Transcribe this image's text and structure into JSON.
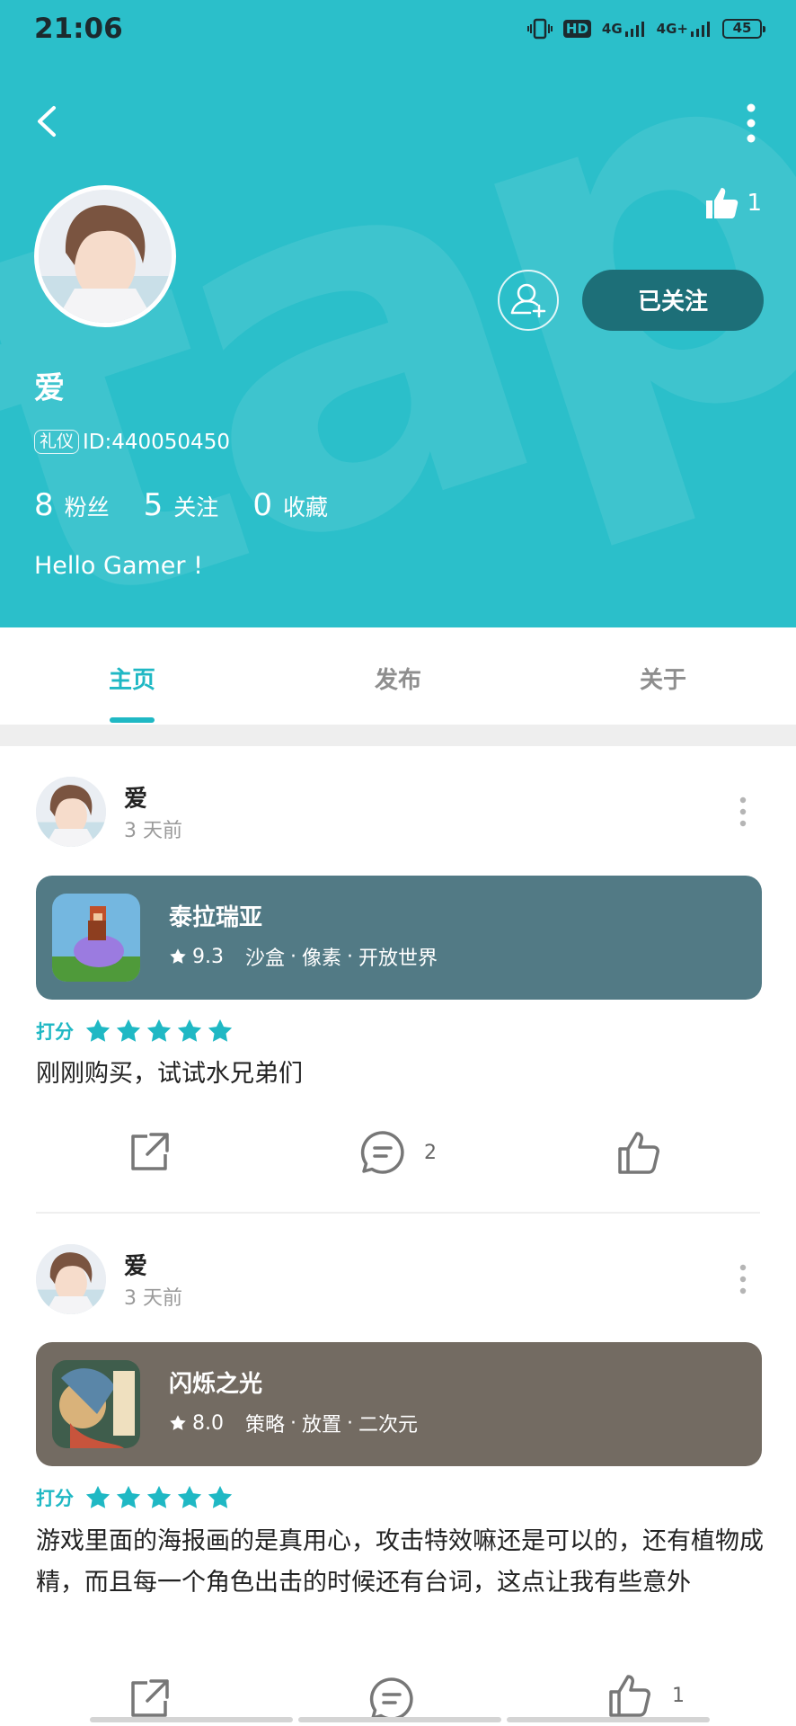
{
  "status_bar": {
    "time": "21:06",
    "hd": "HD",
    "network1": "4G",
    "network2": "4G+",
    "battery": "45"
  },
  "header": {
    "watermark": "tap",
    "like_count": "1",
    "username": "爱",
    "badge": "礼仪",
    "user_id": "ID:440050450",
    "follow_label": "已关注",
    "stats": [
      {
        "value": "8",
        "label": "粉丝"
      },
      {
        "value": "5",
        "label": "关注"
      },
      {
        "value": "0",
        "label": "收藏"
      }
    ],
    "bio": "Hello Gamer !"
  },
  "tabs": [
    {
      "label": "主页",
      "active": true
    },
    {
      "label": "发布",
      "active": false
    },
    {
      "label": "关于",
      "active": false
    }
  ],
  "posts": [
    {
      "author": "爱",
      "time": "3 天前",
      "game": {
        "title": "泰拉瑞亚",
        "score": "9.3",
        "tags": [
          "沙盒",
          "像素",
          "开放世界"
        ],
        "card_color": "#527a85"
      },
      "rating_label": "打分",
      "stars": 5,
      "text": "刚刚购买，试试水兄弟们",
      "comments": "2",
      "likes": ""
    },
    {
      "author": "爱",
      "time": "3 天前",
      "game": {
        "title": "闪烁之光",
        "score": "8.0",
        "tags": [
          "策略",
          "放置",
          "二次元"
        ],
        "card_color": "#736b62"
      },
      "rating_label": "打分",
      "stars": 5,
      "text": "游戏里面的海报画的是真用心，攻击特效嘛还是可以的，还有植物成精，而且每一个角色出击的时候还有台词，这点让我有些意外",
      "comments": "",
      "likes": "1"
    }
  ],
  "colors": {
    "accent": "#1fb8c4",
    "header_bg": "#2bbfca",
    "follow_bg": "#1d6f78"
  }
}
